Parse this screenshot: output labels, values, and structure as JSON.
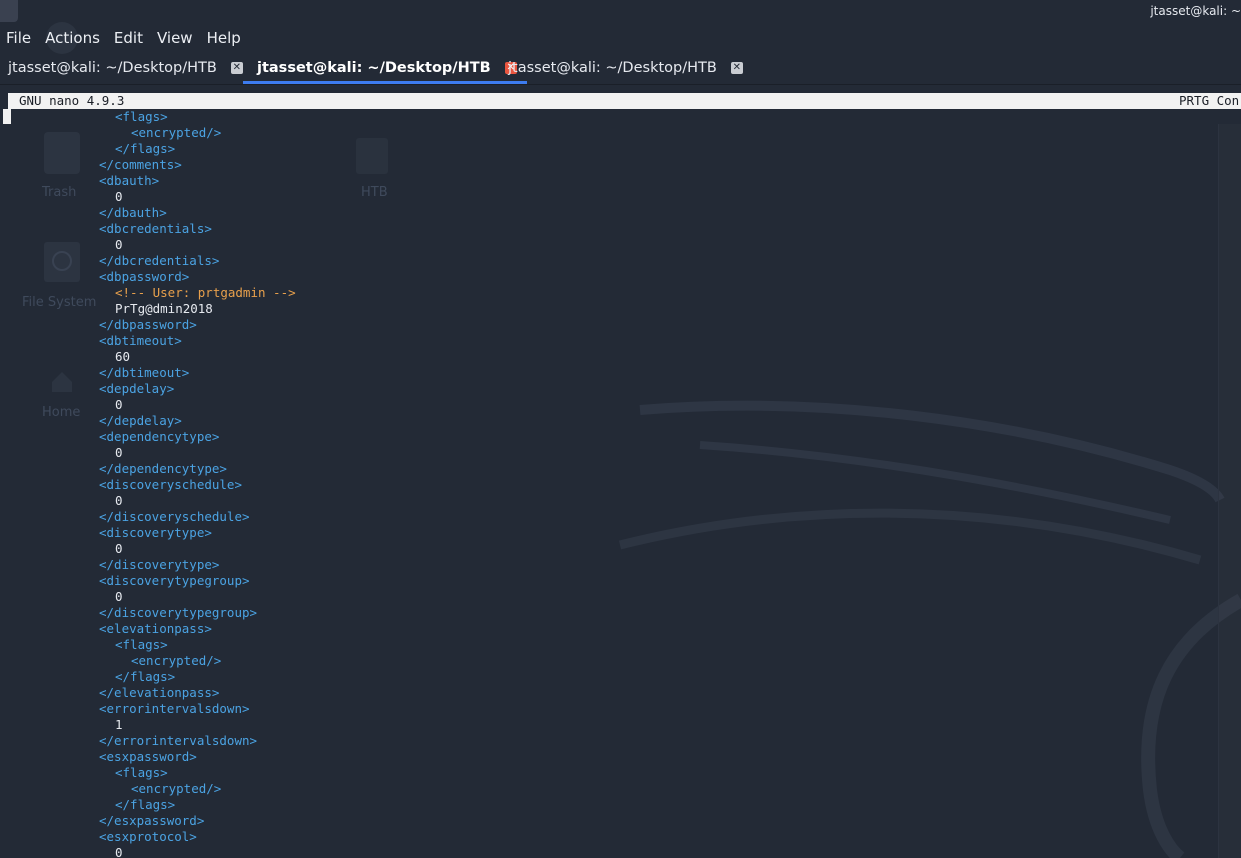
{
  "window": {
    "title": "jtasset@kali: ~"
  },
  "menu": [
    "File",
    "Actions",
    "Edit",
    "View",
    "Help"
  ],
  "tabs": [
    {
      "label": "jtasset@kali: ~/Desktop/HTB",
      "active": false
    },
    {
      "label": "jtasset@kali: ~/Desktop/HTB",
      "active": true
    },
    {
      "label": "jtasset@kali: ~/Desktop/HTB",
      "active": false
    }
  ],
  "desktop": {
    "icons": [
      "Trash",
      "HTB",
      "File System",
      "Home"
    ]
  },
  "nano": {
    "version": "GNU nano 4.9.3",
    "filename": "PRTG Con"
  },
  "lines": [
    {
      "indent": 2,
      "kind": "tag",
      "text": "<flags>"
    },
    {
      "indent": 3,
      "kind": "tag",
      "text": "<encrypted/>"
    },
    {
      "indent": 2,
      "kind": "tag",
      "text": "</flags>"
    },
    {
      "indent": 1,
      "kind": "tag",
      "text": "</comments>"
    },
    {
      "indent": 1,
      "kind": "tag",
      "text": "<dbauth>"
    },
    {
      "indent": 2,
      "kind": "val",
      "text": "0"
    },
    {
      "indent": 1,
      "kind": "tag",
      "text": "</dbauth>"
    },
    {
      "indent": 1,
      "kind": "tag",
      "text": "<dbcredentials>"
    },
    {
      "indent": 2,
      "kind": "val",
      "text": "0"
    },
    {
      "indent": 1,
      "kind": "tag",
      "text": "</dbcredentials>"
    },
    {
      "indent": 1,
      "kind": "tag",
      "text": "<dbpassword>"
    },
    {
      "indent": 2,
      "kind": "comment",
      "text": "<!-- User: prtgadmin -->"
    },
    {
      "indent": 2,
      "kind": "val",
      "text": "PrTg@dmin2018"
    },
    {
      "indent": 1,
      "kind": "tag",
      "text": "</dbpassword>"
    },
    {
      "indent": 1,
      "kind": "tag",
      "text": "<dbtimeout>"
    },
    {
      "indent": 2,
      "kind": "val",
      "text": "60"
    },
    {
      "indent": 1,
      "kind": "tag",
      "text": "</dbtimeout>"
    },
    {
      "indent": 1,
      "kind": "tag",
      "text": "<depdelay>"
    },
    {
      "indent": 2,
      "kind": "val",
      "text": "0"
    },
    {
      "indent": 1,
      "kind": "tag",
      "text": "</depdelay>"
    },
    {
      "indent": 1,
      "kind": "tag",
      "text": "<dependencytype>"
    },
    {
      "indent": 2,
      "kind": "val",
      "text": "0"
    },
    {
      "indent": 1,
      "kind": "tag",
      "text": "</dependencytype>"
    },
    {
      "indent": 1,
      "kind": "tag",
      "text": "<discoveryschedule>"
    },
    {
      "indent": 2,
      "kind": "val",
      "text": "0"
    },
    {
      "indent": 1,
      "kind": "tag",
      "text": "</discoveryschedule>"
    },
    {
      "indent": 1,
      "kind": "tag",
      "text": "<discoverytype>"
    },
    {
      "indent": 2,
      "kind": "val",
      "text": "0"
    },
    {
      "indent": 1,
      "kind": "tag",
      "text": "</discoverytype>"
    },
    {
      "indent": 1,
      "kind": "tag",
      "text": "<discoverytypegroup>"
    },
    {
      "indent": 2,
      "kind": "val",
      "text": "0"
    },
    {
      "indent": 1,
      "kind": "tag",
      "text": "</discoverytypegroup>"
    },
    {
      "indent": 1,
      "kind": "tag",
      "text": "<elevationpass>"
    },
    {
      "indent": 2,
      "kind": "tag",
      "text": "<flags>"
    },
    {
      "indent": 3,
      "kind": "tag",
      "text": "<encrypted/>"
    },
    {
      "indent": 2,
      "kind": "tag",
      "text": "</flags>"
    },
    {
      "indent": 1,
      "kind": "tag",
      "text": "</elevationpass>"
    },
    {
      "indent": 1,
      "kind": "tag",
      "text": "<errorintervalsdown>"
    },
    {
      "indent": 2,
      "kind": "val",
      "text": "1"
    },
    {
      "indent": 1,
      "kind": "tag",
      "text": "</errorintervalsdown>"
    },
    {
      "indent": 1,
      "kind": "tag",
      "text": "<esxpassword>"
    },
    {
      "indent": 2,
      "kind": "tag",
      "text": "<flags>"
    },
    {
      "indent": 3,
      "kind": "tag",
      "text": "<encrypted/>"
    },
    {
      "indent": 2,
      "kind": "tag",
      "text": "</flags>"
    },
    {
      "indent": 1,
      "kind": "tag",
      "text": "</esxpassword>"
    },
    {
      "indent": 1,
      "kind": "tag",
      "text": "<esxprotocol>"
    },
    {
      "indent": 2,
      "kind": "val",
      "text": "0"
    }
  ],
  "colors": {
    "background": "#232a36",
    "tag": "#4ba3e3",
    "value": "#e6e9ef",
    "comment": "#e8a04c",
    "active_tab_underline": "#3d7cf0",
    "active_tab_close": "#e9553f"
  }
}
